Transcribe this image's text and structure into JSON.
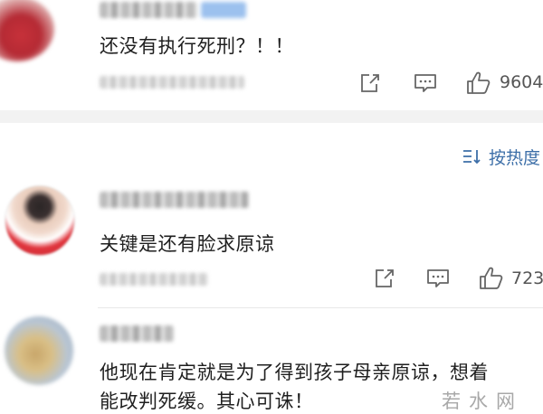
{
  "comments": [
    {
      "text": "还没有执行死刑？！！",
      "share_icon": "share-icon",
      "reply_icon": "comment-icon",
      "like_icon": "thumbs-up-icon",
      "likes": "9604"
    },
    {
      "text": "关键是还有脸求原谅",
      "share_icon": "share-icon",
      "reply_icon": "comment-icon",
      "like_icon": "thumbs-up-icon",
      "likes": "723"
    },
    {
      "text_line1": "他现在肯定就是为了得到孩子母亲原谅，想着",
      "text_line2": "能改判死缓。其心可诛！"
    }
  ],
  "sort": {
    "icon": "sort-icon",
    "label": "按热度"
  },
  "watermark": "若水网",
  "colors": {
    "link": "#3d6fa8",
    "divider": "#f2f2f2",
    "text": "#1f1f1f",
    "meta": "#555555"
  }
}
